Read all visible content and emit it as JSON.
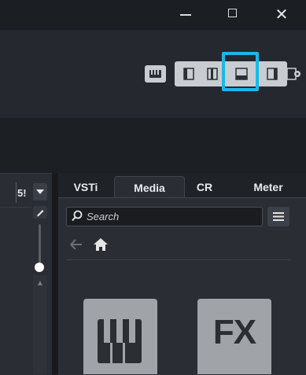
{
  "window_controls": {
    "minimize": "–",
    "maximize": "□",
    "close": "✕"
  },
  "toolbar": {
    "keyboard_icon": "keyboard-icon",
    "layout_buttons": [
      "show-left-zone",
      "show-left-right",
      "show-lower-zone",
      "show-right-zone"
    ],
    "active_layout": "show-lower-zone",
    "highlight_color": "#19b8e8",
    "window_settings_icon": "window-settings-icon"
  },
  "track": {
    "number": "5!"
  },
  "right_zone": {
    "tabs": [
      {
        "label": "VSTi",
        "active": false
      },
      {
        "label": "Media",
        "active": true
      },
      {
        "label": "CR",
        "active": false
      },
      {
        "label": "Meter",
        "active": false
      }
    ],
    "search": {
      "placeholder": "Search"
    },
    "tiles": [
      {
        "name": "instruments",
        "icon": "piano-keys-icon",
        "label": ""
      },
      {
        "name": "effects",
        "icon": "fx-icon",
        "label": "FX"
      }
    ]
  }
}
